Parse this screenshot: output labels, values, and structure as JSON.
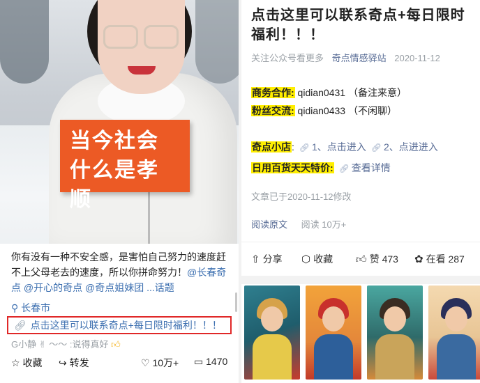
{
  "left": {
    "banner": {
      "line1": "当今社会",
      "line2": "什么是孝顺"
    },
    "caption": {
      "text": "你有没有一种不安全感，是害怕自己努力的速度赶不上父母老去的速度，所以你拼命努力！",
      "mention1": "@长春奇点",
      "mention2": "@开心的奇点",
      "mention3": "@奇点姐妹团",
      "more": "...话题"
    },
    "location": "长春市",
    "link_text": "点击这里可以联系奇点+每日限时福利！！！",
    "comment": {
      "user": "G小静",
      "text": ":说得真好"
    },
    "actions": {
      "collect": "收藏",
      "share": "转发",
      "likes": "10万+",
      "comments": "1470"
    }
  },
  "right": {
    "title": "点击这里可以联系奇点+每日限时福利！！！",
    "meta": {
      "prefix": "关注公众号看更多",
      "account": "奇点情感驿站",
      "date": "2020-11-12"
    },
    "business": {
      "label": "商务合作:",
      "value": " qidian0431 （备注来意）"
    },
    "fans": {
      "label": "粉丝交流:",
      "value": " qidian0433 （不闲聊）"
    },
    "shop": {
      "label": "奇点小店",
      "sep": ":",
      "link1": "1、点击进入",
      "link2": "2、点进进入"
    },
    "daily": {
      "label": "日用百货天天特价:",
      "link": "查看详情"
    },
    "edited": "文章已于2020-11-12修改",
    "read": {
      "original": "阅读原文",
      "count": "阅读 10万+"
    },
    "bar": {
      "share": "分享",
      "collect": "收藏",
      "like": "赞 473",
      "looking": "在看 287"
    }
  },
  "colors": {
    "accent_blue": "#576b95",
    "highlight": "#ffee00",
    "banner_orange": "#ec5a25",
    "link_border_red": "#e02828"
  }
}
